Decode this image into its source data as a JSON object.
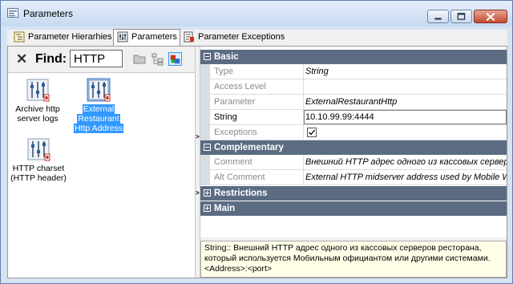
{
  "window": {
    "title": "Parameters"
  },
  "tabs": [
    {
      "label": "Parameter Hierarhies",
      "active": false
    },
    {
      "label": "Parameters",
      "active": true
    },
    {
      "label": "Parameter Exceptions",
      "active": false
    }
  ],
  "find": {
    "label": "Find:",
    "value": "HTTP"
  },
  "items": [
    {
      "label_line1": "Archive http",
      "label_line2": "server logs",
      "label_line3": "",
      "selected": false
    },
    {
      "label_line1": "External",
      "label_line2": "Restaurant",
      "label_line3": "Http Address",
      "selected": true
    },
    {
      "label_line1": "HTTP charset",
      "label_line2": "(HTTP header)",
      "label_line3": "",
      "selected": false
    }
  ],
  "categories": {
    "basic": "Basic",
    "complementary": "Complementary",
    "restrictions": "Restrictions",
    "main": "Main"
  },
  "properties": {
    "type": {
      "name": "Type",
      "value": "String"
    },
    "access_level": {
      "name": "Access Level",
      "value": ""
    },
    "parameter": {
      "name": "Parameter",
      "value": "ExternalRestaurantHttp"
    },
    "string": {
      "name": "String",
      "value": "10.10.99.99:4444"
    },
    "exceptions": {
      "name": "Exceptions",
      "checked": true
    },
    "comment": {
      "name": "Comment",
      "value": "Внешний HTTP адрес одного из кассовых серверов"
    },
    "alt_comment": {
      "name": "Alt Comment",
      "value": "External HTTP midserver address used by Mobile Waiter"
    }
  },
  "description": {
    "line1": "String:: Внешний HTTP адрес одного из кассовых серверов ресторана,",
    "line2": "который используется Мобильным официантом или другими системами.",
    "line3": "<Address>:<port>"
  },
  "colors": {
    "category_header": "#5b6c82",
    "selection": "#3399ff",
    "description_bg": "#ffffe8"
  }
}
